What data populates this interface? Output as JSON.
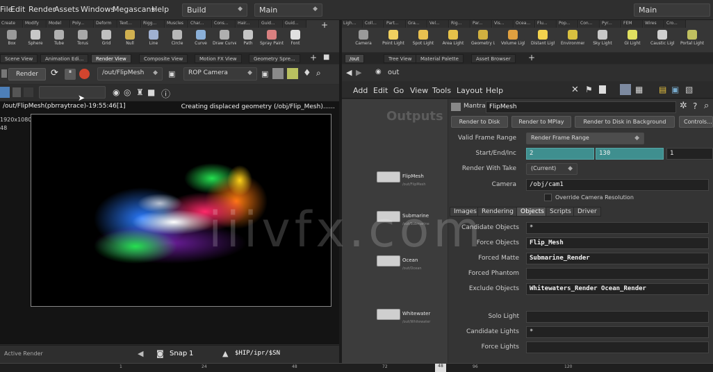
{
  "menubar": {
    "items": [
      "File",
      "Edit",
      "Render",
      "Assets",
      "Windows",
      "Megascans",
      "Help"
    ],
    "desktop": "Build",
    "context": "Main",
    "right_context": "Main"
  },
  "left_shelf": {
    "tabs": [
      "Create",
      "Modify",
      "Model",
      "Poly...",
      "Deform",
      "Text...",
      "Rigg...",
      "Muscles",
      "Char...",
      "Cons...",
      "Hair...",
      "Guid...",
      "Guid..."
    ],
    "tools": [
      {
        "label": "Box",
        "color": "#9a9a9a"
      },
      {
        "label": "Sphere",
        "color": "#c8c8c8"
      },
      {
        "label": "Tube",
        "color": "#b0b0b0"
      },
      {
        "label": "Torus",
        "color": "#a9a9a9"
      },
      {
        "label": "Grid",
        "color": "#c0c0c0"
      },
      {
        "label": "Null",
        "color": "#d0b050"
      },
      {
        "label": "Line",
        "color": "#9fb0d0"
      },
      {
        "label": "Circle",
        "color": "#b8b8b8"
      },
      {
        "label": "Curve",
        "color": "#8bb0d8"
      },
      {
        "label": "Draw Curve",
        "color": "#b0b0b0"
      },
      {
        "label": "Path",
        "color": "#c5c5c5"
      },
      {
        "label": "Spray Paint",
        "color": "#d98080"
      },
      {
        "label": "Font",
        "color": "#e0e0e0"
      }
    ]
  },
  "right_shelf": {
    "tabs": [
      "Ligh...",
      "Coll...",
      "Part...",
      "Gra...",
      "Vel...",
      "Rig...",
      "Par...",
      "Vis...",
      "Ocea...",
      "Flu...",
      "Pop...",
      "Con...",
      "Pyr...",
      "FEM",
      "Wires",
      "Cro..."
    ],
    "tools": [
      {
        "label": "Camera",
        "color": "#9a9a9a"
      },
      {
        "label": "Point Light",
        "color": "#f0d060"
      },
      {
        "label": "Spot Light",
        "color": "#e8c050"
      },
      {
        "label": "Area Light",
        "color": "#e6c24a"
      },
      {
        "label": "Geometry Light",
        "color": "#d0b040"
      },
      {
        "label": "Volume Light",
        "color": "#e0a040"
      },
      {
        "label": "Distant Light",
        "color": "#f2d24e"
      },
      {
        "label": "Environment Light",
        "color": "#d8c040"
      },
      {
        "label": "Sky Light",
        "color": "#c8c8c8"
      },
      {
        "label": "GI Light",
        "color": "#e0e060"
      },
      {
        "label": "Caustic Light",
        "color": "#d0d0d0"
      },
      {
        "label": "Portal Light",
        "color": "#c0c060"
      }
    ]
  },
  "left_pane_tabs": [
    "Scene View",
    "Animation Edi...",
    "Render View",
    "Composite View",
    "Motion FX View",
    "Geometry Spre..."
  ],
  "right_pane_tabs": [
    "/out",
    "Tree View",
    "Material Palette",
    "Asset Browser"
  ],
  "render_bar": {
    "render_label": "Render",
    "rop_path": "/out/FlipMesh",
    "camera": "ROP Camera"
  },
  "viewport": {
    "info_left": "/out/FlipMesh(pbrraytrace)-19:55:46[1]",
    "info_right": "Creating displaced geometry (/obj/Flip_Mesh)......",
    "resolution": "1920x1080",
    "frame": "48"
  },
  "left_status": {
    "label": "Active Render",
    "snap_label": "Snap",
    "snap_value": "1",
    "path": "$HIP/ipr/$SN"
  },
  "timeline": {
    "ticks": [
      "1",
      "24",
      "48",
      "72",
      "96",
      "120"
    ],
    "current": "48"
  },
  "right_path": {
    "path": "out"
  },
  "right_menu": [
    "Add",
    "Edit",
    "Go",
    "View",
    "Tools",
    "Layout",
    "Help"
  ],
  "network": {
    "title": "Outputs",
    "nodes": [
      {
        "name": "FlipMesh",
        "sub": "/out/FlipMesh"
      },
      {
        "name": "Submarine",
        "sub": "/out/Submarine"
      },
      {
        "name": "Ocean",
        "sub": "/out/Ocean"
      },
      {
        "name": "Whitewater",
        "sub": "/out/Whitewater"
      }
    ]
  },
  "params": {
    "node_type": "Mantra",
    "node_name": "FlipMesh",
    "buttons": [
      "Render to Disk",
      "Render to MPlay",
      "Render to Disk in Background",
      "Controls..."
    ],
    "valid_frame_range_label": "Valid Frame Range",
    "valid_frame_range": "Render Frame Range",
    "start_end_inc_label": "Start/End/Inc",
    "start": "2",
    "end": "130",
    "inc": "1",
    "render_with_take_label": "Render With Take",
    "render_with_take": "(Current)",
    "camera_label": "Camera",
    "camera": "/obj/cam1",
    "override_res": "Override Camera Resolution",
    "tabs": [
      "Images",
      "Rendering",
      "Objects",
      "Scripts",
      "Driver"
    ],
    "candidate_objects_label": "Candidate Objects",
    "candidate_objects": "*",
    "force_objects_label": "Force Objects",
    "force_objects": "Flip_Mesh",
    "forced_matte_label": "Forced Matte",
    "forced_matte": "Submarine_Render",
    "forced_phantom_label": "Forced Phantom",
    "forced_phantom": "",
    "exclude_objects_label": "Exclude Objects",
    "exclude_objects": "Whitewaters_Render Ocean_Render",
    "solo_light_label": "Solo Light",
    "solo_light": "",
    "candidate_lights_label": "Candidate Lights",
    "candidate_lights": "*",
    "force_lights_label": "Force Lights",
    "force_lights": ""
  },
  "watermark": "iiivfx.com",
  "colors": {
    "accent": "#3f8f8f",
    "render_stop": "#d2452e"
  }
}
